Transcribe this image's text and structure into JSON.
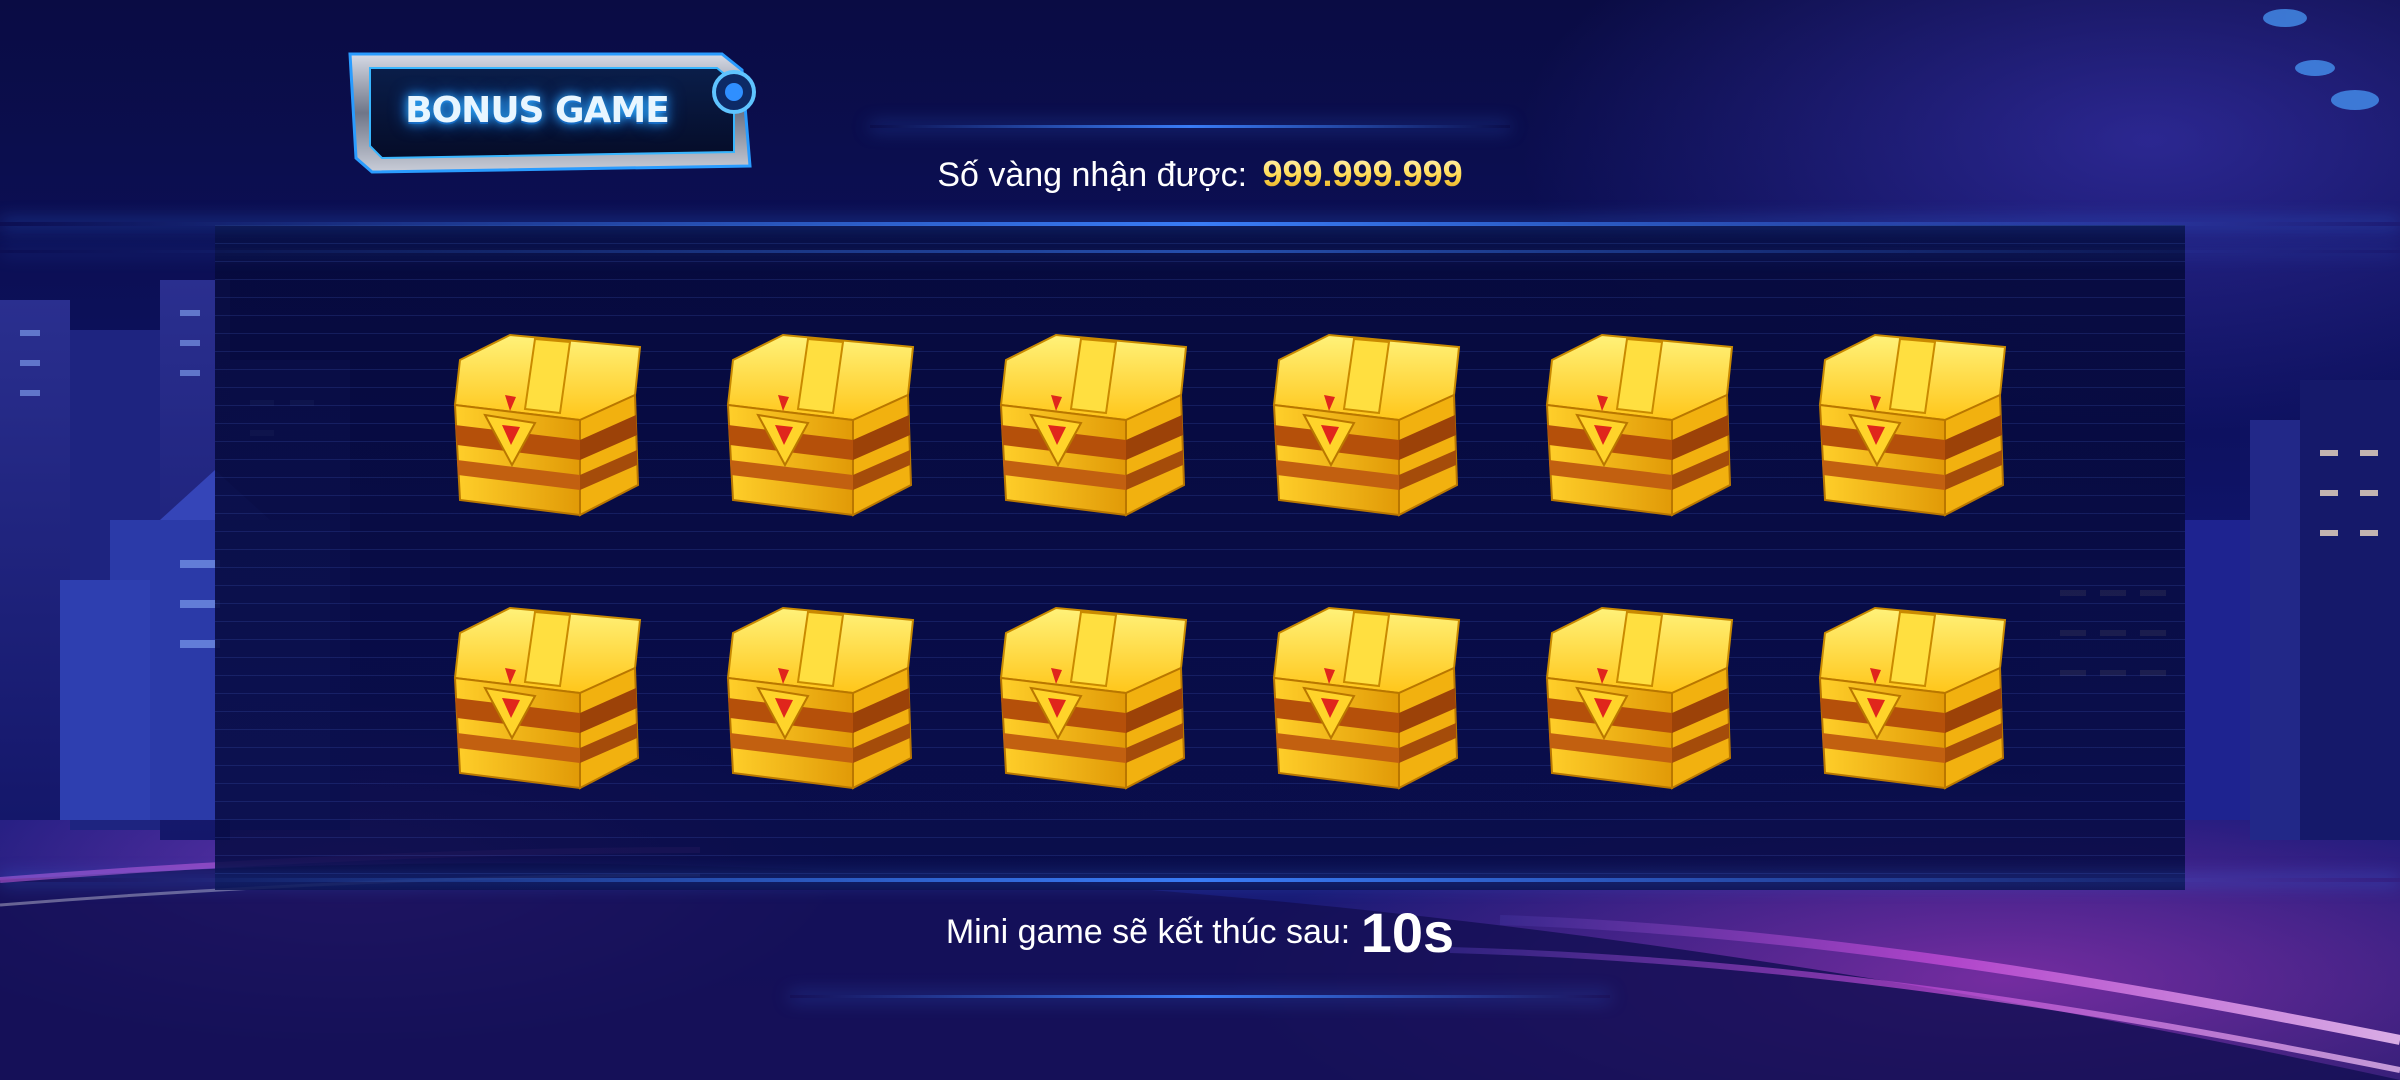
{
  "header": {
    "badge_title": "BONUS GAME"
  },
  "reward": {
    "label": "Số vàng nhận được:",
    "value": "999.999.999"
  },
  "countdown": {
    "label": "Mini game sẽ kết thúc sau:",
    "value": "10s"
  },
  "chests": [
    {
      "row": 1,
      "col": 1
    },
    {
      "row": 1,
      "col": 2
    },
    {
      "row": 1,
      "col": 3
    },
    {
      "row": 1,
      "col": 4
    },
    {
      "row": 1,
      "col": 5
    },
    {
      "row": 1,
      "col": 6
    },
    {
      "row": 2,
      "col": 1
    },
    {
      "row": 2,
      "col": 2
    },
    {
      "row": 2,
      "col": 3
    },
    {
      "row": 2,
      "col": 4
    },
    {
      "row": 2,
      "col": 5
    },
    {
      "row": 2,
      "col": 6
    }
  ],
  "colors": {
    "background": "#0d1160",
    "accent_blue": "#3c82ff",
    "gold": "#ffd84a"
  },
  "icons": {
    "chest": "treasure-chest-icon"
  }
}
